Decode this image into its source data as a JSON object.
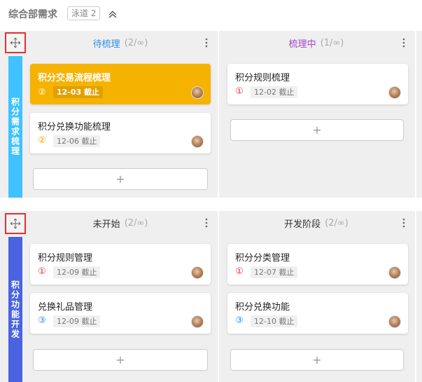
{
  "header": {
    "title": "综合部需求",
    "lane_badge": "泳道 2"
  },
  "colors": {
    "lane1_label": "#3fc2ff",
    "lane2_label": "#4a63e0",
    "highlight_card": "#f5b300",
    "todo_title": "#2f8fe8",
    "inprogress_title": "#a647c9",
    "priority_high": "#e03131",
    "priority_mid": "#f59f00",
    "priority_low": "#2f8fe8"
  },
  "lanes": [
    {
      "label": "积分需求梳理",
      "columns": [
        {
          "name": "待梳理",
          "count": "(2/∞)",
          "cards": [
            {
              "title": "积分交易流程梳理",
              "priority": "②",
              "due": "12-03 截止",
              "highlight": true
            },
            {
              "title": "积分兑换功能梳理",
              "priority": "②",
              "due": "12-06 截止",
              "highlight": false
            }
          ],
          "add_label": "+"
        },
        {
          "name": "梳理中",
          "count": "(1/∞)",
          "cards": [
            {
              "title": "积分规则梳理",
              "priority": "①",
              "due": "12-02 截止",
              "highlight": false
            }
          ],
          "add_label": "+"
        }
      ]
    },
    {
      "label": "积分功能开发",
      "columns": [
        {
          "name": "未开始",
          "count": "(2/∞)",
          "cards": [
            {
              "title": "积分规则管理",
              "priority": "①",
              "due": "12-09 截止",
              "highlight": false
            },
            {
              "title": "兑换礼品管理",
              "priority": "③",
              "due": "12-09 截止",
              "highlight": false
            }
          ],
          "add_label": "+"
        },
        {
          "name": "开发阶段",
          "count": "(2/∞)",
          "cards": [
            {
              "title": "积分分类管理",
              "priority": "①",
              "due": "12-07 截止",
              "highlight": false
            },
            {
              "title": "积分兑换功能",
              "priority": "③",
              "due": "12-10 截止",
              "highlight": false
            }
          ],
          "add_label": "+"
        }
      ]
    }
  ]
}
